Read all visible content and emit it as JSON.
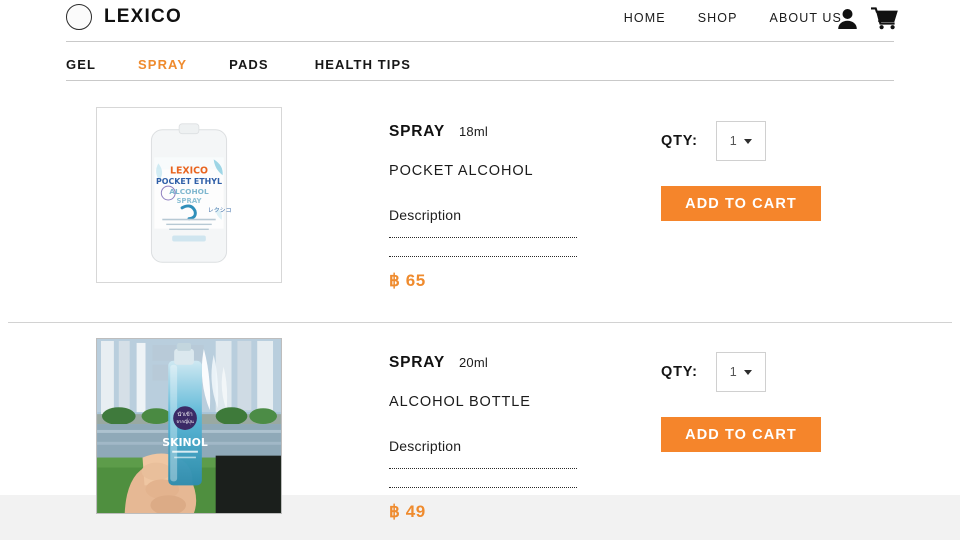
{
  "header": {
    "brand": "LEXICO",
    "brand_logo_icon": "circle-outline-logo",
    "nav": [
      {
        "label": "HOME",
        "name": "nav-home"
      },
      {
        "label": "SHOP",
        "name": "nav-shop"
      },
      {
        "label": "ABOUT US",
        "name": "nav-about-us"
      }
    ],
    "icons": [
      {
        "name": "account-icon",
        "glyph": "person"
      },
      {
        "name": "cart-icon",
        "glyph": "shopping-cart"
      }
    ]
  },
  "subnav": {
    "items": [
      {
        "label": "GEL",
        "active": false
      },
      {
        "label": "SPRAY",
        "active": true
      },
      {
        "label": "PADS",
        "active": false
      },
      {
        "label": "HEALTH TIPS",
        "active": false
      }
    ],
    "active_color": "#ef8b2e"
  },
  "products": [
    {
      "type": "SPRAY",
      "size": "18ml",
      "name": "POCKET ALCOHOL",
      "description_label": "Description",
      "description_lines": [
        "",
        ""
      ],
      "price": "฿ 65",
      "qty_label": "QTY:",
      "qty_value": "1",
      "add_to_cart_label": "ADD TO CART",
      "image_alt": "LEXICO POCKET ETHYL ALCOHOL SPRAY flat pocket bottle"
    },
    {
      "type": "SPRAY",
      "size": "20ml",
      "name": "ALCOHOL BOTTLE",
      "description_label": "Description",
      "description_lines": [
        "",
        ""
      ],
      "price": "฿ 49",
      "qty_label": "QTY:",
      "qty_value": "1",
      "add_to_cart_label": "ADD TO CART",
      "image_alt": "Hand holding blue SKINOL spray bottle in front of fountain"
    }
  ],
  "colors": {
    "accent_orange": "#ef8b2e",
    "button_orange": "#f5852b",
    "text_dark": "#111111",
    "rule_gray": "#c9c9c9",
    "footer_band": "#f2f2f2"
  }
}
